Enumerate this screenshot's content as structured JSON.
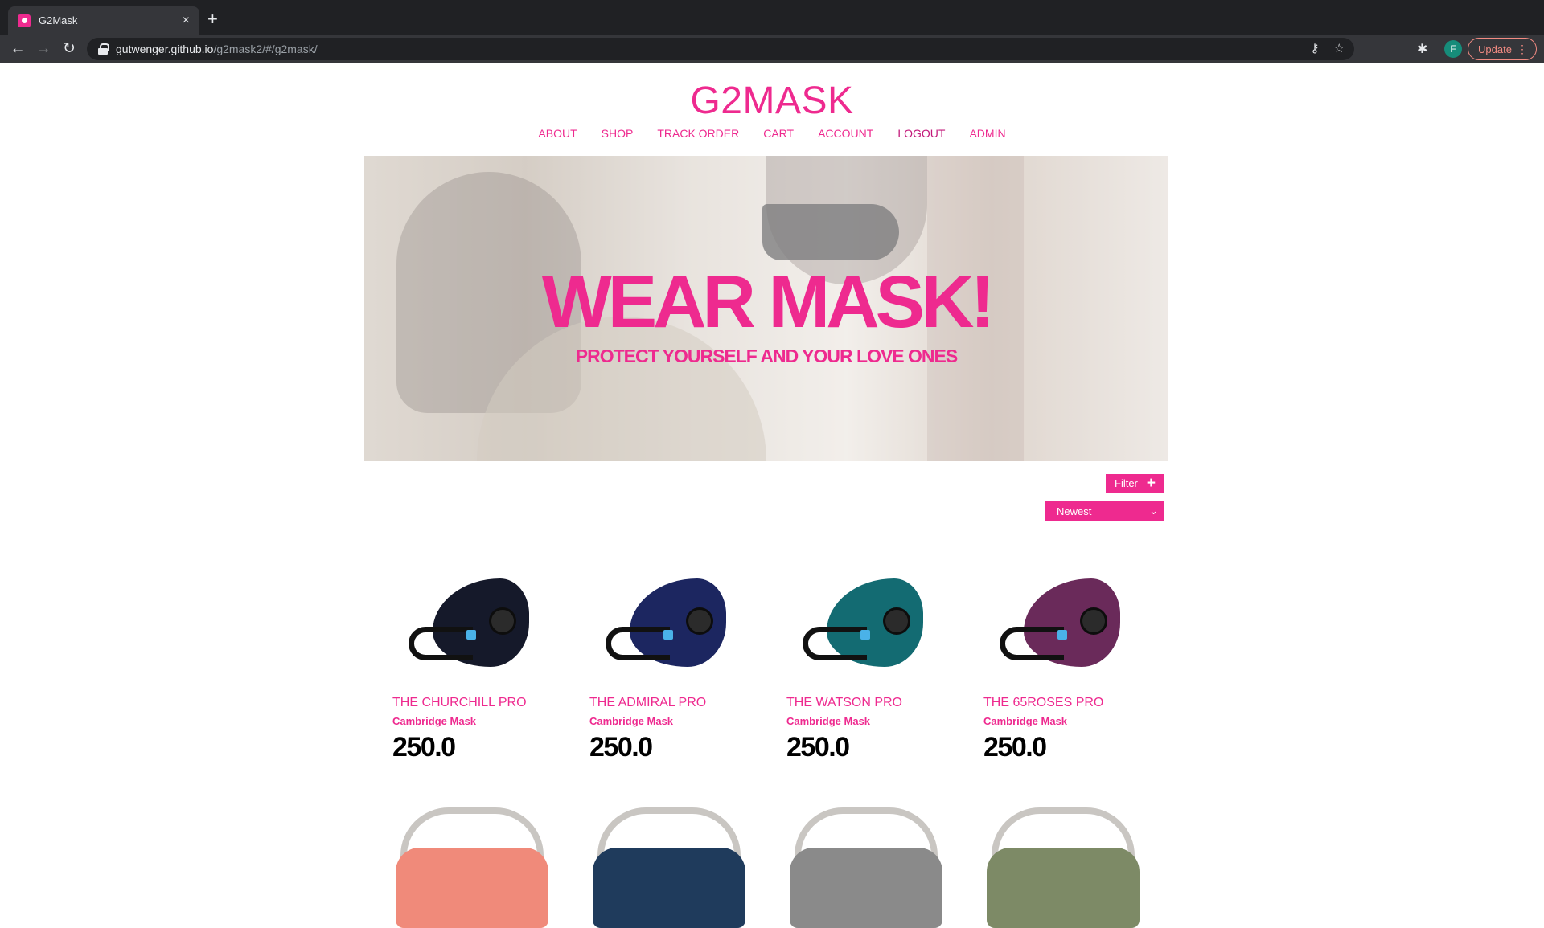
{
  "browser": {
    "tab_title": "G2Mask",
    "tab_close": "×",
    "new_tab": "+",
    "url_host": "gutwenger.github.io",
    "url_path": "/g2mask2/#/g2mask/",
    "profile_initial": "F",
    "update_label": "Update",
    "icons": {
      "back": "back-arrow-icon",
      "forward": "forward-arrow-icon",
      "reload": "reload-icon",
      "lock": "lock-icon",
      "key": "key-icon",
      "star": "star-icon",
      "extensions": "puzzle-icon",
      "menu": "kebab-menu-icon"
    }
  },
  "site": {
    "brand": "G2MASK",
    "nav": [
      "ABOUT",
      "SHOP",
      "TRACK ORDER",
      "CART",
      "ACCOUNT",
      "LOGOUT",
      "ADMIN"
    ],
    "active_nav": "LOGOUT",
    "accent_color": "#ee2a8f"
  },
  "hero": {
    "headline": "WEAR MASK!",
    "subheadline": "PROTECT YOURSELF AND YOUR LOVE ONES"
  },
  "controls": {
    "filter_label": "Filter",
    "filter_icon": "+",
    "sort_selected": "Newest",
    "sort_chevron": "⌄"
  },
  "products": [
    {
      "name": "THE CHURCHILL PRO",
      "brand": "Cambridge Mask",
      "price": "250.0",
      "color": "#15192a"
    },
    {
      "name": "THE ADMIRAL PRO",
      "brand": "Cambridge Mask",
      "price": "250.0",
      "color": "#1c2660"
    },
    {
      "name": "THE WATSON PRO",
      "brand": "Cambridge Mask",
      "price": "250.0",
      "color": "#136b72"
    },
    {
      "name": "THE 65ROSES PRO",
      "brand": "Cambridge Mask",
      "price": "250.0",
      "color": "#6a2a5a"
    }
  ],
  "products_row2_colors": [
    "#f08a7a",
    "#1f3b5c",
    "#8a8a8a",
    "#7d8a66"
  ]
}
